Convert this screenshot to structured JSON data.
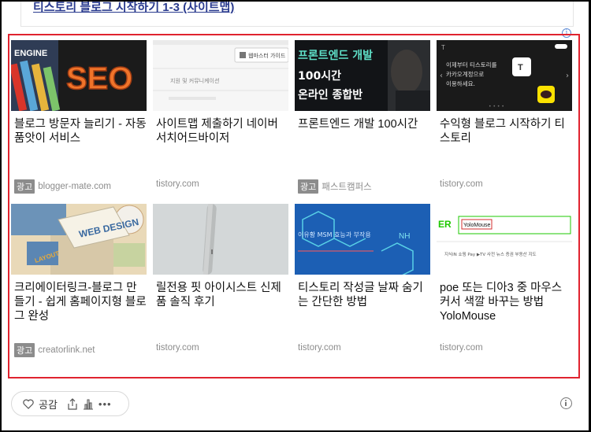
{
  "prev_post": {
    "title": "티스토리 블로그 시작하기 1-3 (사이트맵)"
  },
  "ad_info": {
    "icon": "info-icon"
  },
  "cards": [
    {
      "title": "블로그 방문자 늘리기 - 자동 품앗이 서비스",
      "source": "blogger-mate.com",
      "ad_label": "광고",
      "thumb_text": "SEO",
      "thumb_extra": "ENGINE"
    },
    {
      "title": "사이트맵 제출하기 네이버 서치어드바이저",
      "source": "tistory.com",
      "thumb_text": "웹마스터 가이드",
      "thumb_extra": "지원 및 커뮤니케이션"
    },
    {
      "title": "프론트엔드 개발 100시간",
      "source": "패스트캠퍼스",
      "ad_label": "광고",
      "thumb_text": "프론트엔드 개발",
      "thumb_extra": "100시간",
      "thumb_extra2": "온라인 종합반"
    },
    {
      "title": "수익형 블로그 시작하기 티스토리",
      "source": "tistory.com",
      "thumb_text": "이제부터 티스토리를",
      "thumb_extra": "카카오계정으로",
      "thumb_extra2": "이용하세요."
    },
    {
      "title": "크리에이터링크-블로그 만들기 - 쉽게 홈페이지형 블로그 완성",
      "source": "creatorlink.net",
      "ad_label": "광고",
      "thumb_text": "WEB DESIGN",
      "thumb_extra": "LAYOUT"
    },
    {
      "title": "릴전용 핏 아이시스트 신제품 솔직 후기",
      "source": "tistory.com"
    },
    {
      "title": "티스토리 작성글 날짜 숨기는 간단한 방법",
      "source": "tistory.com",
      "thumb_text": "이유황 MSM 효능과 부작용"
    },
    {
      "title": "poe 또는 디아3 중 마우스 커서 색깔 바꾸는 방법 YoloMouse",
      "source": "tistory.com",
      "thumb_text": "YoloMouse",
      "thumb_extra": "ER"
    }
  ],
  "reactions": {
    "like_label": "공감",
    "like_icon": "heart-icon",
    "share_icon": "share-icon",
    "stats_icon": "stats-icon",
    "more_icon": "more-icon"
  },
  "colors": {
    "ad_border": "#e0232f",
    "link": "#2a3b8f"
  }
}
